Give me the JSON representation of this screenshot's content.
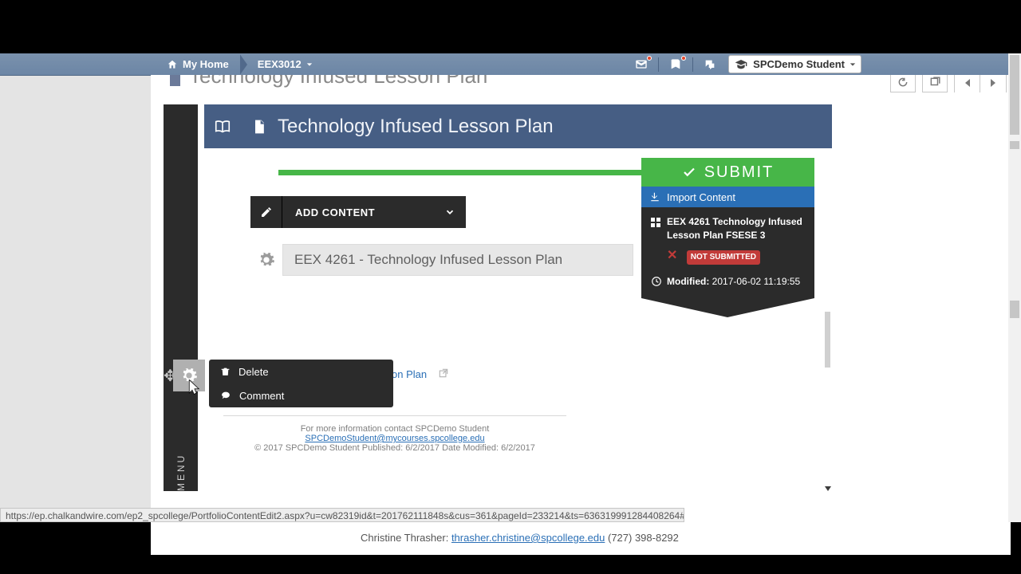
{
  "nav": {
    "home": "My Home",
    "course": "EEX3012",
    "user": "SPCDemo Student"
  },
  "page": {
    "heading": "Technology Infused Lesson Plan"
  },
  "viewer": {
    "menu_label": "MENU",
    "title": "Technology Infused Lesson Plan",
    "submit": "SUBMIT",
    "add_content": "ADD CONTENT",
    "section_title": "EEX 4261 - Technology Infused Lesson Plan",
    "import_label": "Import Content",
    "submission": {
      "name": "EEX 4261 Technology Infused Lesson Plan FSESE 3",
      "status": "NOT SUBMITTED",
      "modified_label": "Modified:",
      "modified_value": "2017-06-02 11:19:55"
    },
    "popup": {
      "delete": "Delete",
      "comment": "Comment"
    },
    "hidden_link_tail": "on Plan",
    "footer": {
      "line1": "For more information contact SPCDemo Student",
      "email": "SPCDemoStudent@mycourses.spcollege.edu",
      "line3": "© 2017 SPCDemo Student Published: 6/2/2017 Date Modified: 6/2/2017"
    }
  },
  "credit": {
    "name": "Christine Thrasher:",
    "email": "thrasher.christine@spcollege.edu",
    "phone": "(727) 398-8292"
  },
  "status_url": "https://ep.chalkandwire.com/ep2_spcollege/PortfolioContentEdit2.aspx?u=cw82319id&t=201762111848s&cus=361&pageId=233214&ts=636319991284408264#"
}
